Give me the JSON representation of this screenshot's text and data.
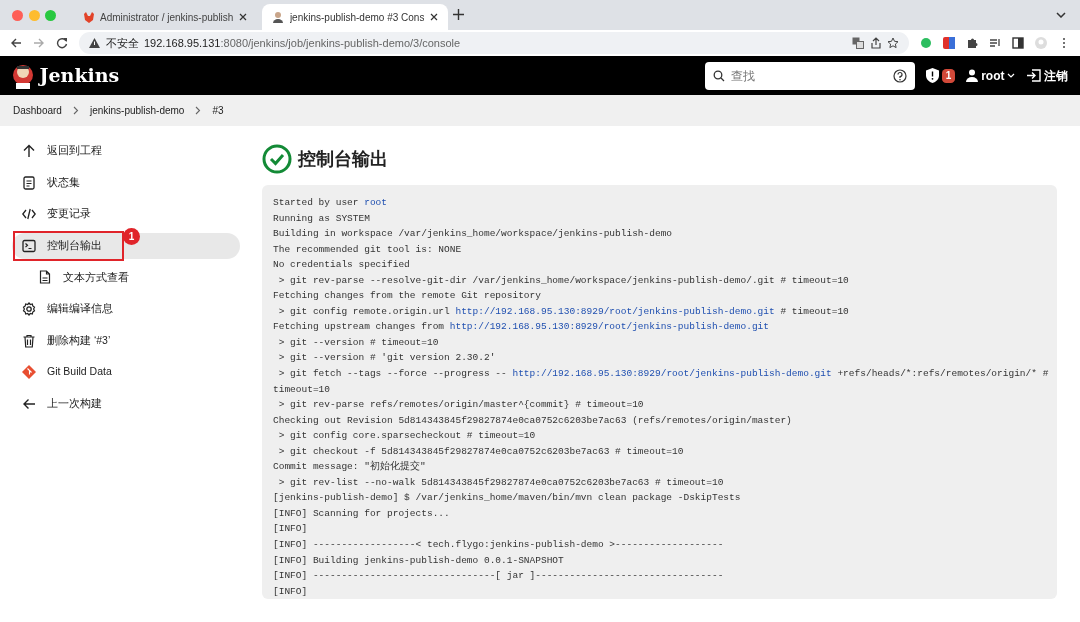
{
  "browser": {
    "tabs": [
      {
        "title": "Administrator / jenkins-publish",
        "selected": false
      },
      {
        "title": "jenkins-publish-demo #3 Cons",
        "selected": true
      }
    ],
    "address": {
      "warning": "不安全",
      "host": "192.168.95.131",
      "path": ":8080/jenkins/job/jenkins-publish-demo/3/console"
    }
  },
  "header": {
    "brand": "Jenkins",
    "search_placeholder": "查找",
    "alert_count": "1",
    "user": "root",
    "logout": "注销"
  },
  "breadcrumbs": [
    "Dashboard",
    "jenkins-publish-demo",
    "#3"
  ],
  "sidebar": {
    "items": [
      {
        "label": "返回到工程",
        "selected": false
      },
      {
        "label": "状态集",
        "selected": false
      },
      {
        "label": "变更记录",
        "selected": false
      },
      {
        "label": "控制台输出",
        "selected": true,
        "annotation": "1",
        "children": [
          {
            "label": "文本方式查看",
            "selected": false
          }
        ]
      },
      {
        "label": "编辑编译信息",
        "selected": false
      },
      {
        "label": "删除构建 ‘#3’",
        "selected": false
      },
      {
        "label": "Git Build Data",
        "selected": false
      },
      {
        "label": "上一次构建",
        "selected": false
      }
    ]
  },
  "page_title": "控制台输出",
  "console": {
    "lines": [
      [
        {
          "text": "Started by user ",
          "link": false
        },
        {
          "text": "root",
          "link": true
        }
      ],
      [
        {
          "text": "Running as SYSTEM",
          "link": false
        }
      ],
      [
        {
          "text": "Building in workspace /var/jenkins_home/workspace/jenkins-publish-demo",
          "link": false
        }
      ],
      [
        {
          "text": "The recommended git tool is: NONE",
          "link": false
        }
      ],
      [
        {
          "text": "No credentials specified",
          "link": false
        }
      ],
      [
        {
          "text": " > git rev-parse --resolve-git-dir /var/jenkins_home/workspace/jenkins-publish-demo/.git # timeout=10",
          "link": false
        }
      ],
      [
        {
          "text": "Fetching changes from the remote Git repository",
          "link": false
        }
      ],
      [
        {
          "text": " > git config remote.origin.url ",
          "link": false
        },
        {
          "text": "http://192.168.95.130:8929/root/jenkins-publish-demo.git",
          "link": true
        },
        {
          "text": " # timeout=10",
          "link": false
        }
      ],
      [
        {
          "text": "Fetching upstream changes from ",
          "link": false
        },
        {
          "text": "http://192.168.95.130:8929/root/jenkins-publish-demo.git",
          "link": true
        }
      ],
      [
        {
          "text": " > git --version # timeout=10",
          "link": false
        }
      ],
      [
        {
          "text": " > git --version # 'git version 2.30.2'",
          "link": false
        }
      ],
      [
        {
          "text": " > git fetch --tags --force --progress -- ",
          "link": false
        },
        {
          "text": "http://192.168.95.130:8929/root/jenkins-publish-demo.git",
          "link": true
        },
        {
          "text": " +refs/heads/*:refs/remotes/origin/* #",
          "link": false
        }
      ],
      [
        {
          "text": "timeout=10",
          "link": false
        }
      ],
      [
        {
          "text": " > git rev-parse refs/remotes/origin/master^{commit} # timeout=10",
          "link": false
        }
      ],
      [
        {
          "text": "Checking out Revision 5d814343845f29827874e0ca0752c6203be7ac63 (refs/remotes/origin/master)",
          "link": false
        }
      ],
      [
        {
          "text": " > git config core.sparsecheckout # timeout=10",
          "link": false
        }
      ],
      [
        {
          "text": " > git checkout -f 5d814343845f29827874e0ca0752c6203be7ac63 # timeout=10",
          "link": false
        }
      ],
      [
        {
          "text": "Commit message: \"初始化提交\"",
          "link": false
        }
      ],
      [
        {
          "text": " > git rev-list --no-walk 5d814343845f29827874e0ca0752c6203be7ac63 # timeout=10",
          "link": false
        }
      ],
      [
        {
          "text": "[jenkins-publish-demo] $ /var/jenkins_home/maven/bin/mvn clean package -DskipTests",
          "link": false
        }
      ],
      [
        {
          "text": "[INFO] Scanning for projects...",
          "link": false
        }
      ],
      [
        {
          "text": "[INFO]",
          "link": false
        }
      ],
      [
        {
          "text": "[INFO] ------------------< tech.flygo:jenkins-publish-demo >-------------------",
          "link": false
        }
      ],
      [
        {
          "text": "[INFO] Building jenkins-publish-demo 0.0.1-SNAPSHOT",
          "link": false
        }
      ],
      [
        {
          "text": "[INFO] --------------------------------[ jar ]---------------------------------",
          "link": false
        }
      ],
      [
        {
          "text": "[INFO]",
          "link": false
        }
      ]
    ]
  }
}
